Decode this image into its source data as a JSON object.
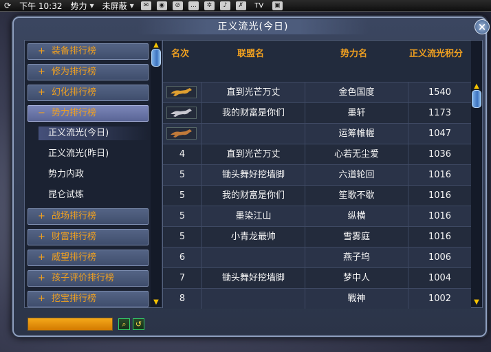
{
  "hud": {
    "time": "下午 10:32",
    "faction": "势力",
    "block": "未屏蔽",
    "tv": "TV"
  },
  "window": {
    "title": "正义流光(今日)"
  },
  "categories": [
    {
      "label": "装备排行榜",
      "sign": "+"
    },
    {
      "label": "修为排行榜",
      "sign": "+"
    },
    {
      "label": "幻化排行榜",
      "sign": "+"
    },
    {
      "label": "势力排行榜",
      "sign": "−"
    },
    {
      "label": "战场排行榜",
      "sign": "+"
    },
    {
      "label": "财富排行榜",
      "sign": "+"
    },
    {
      "label": "威望排行榜",
      "sign": "+"
    },
    {
      "label": "孩子评价排行榜",
      "sign": "+"
    },
    {
      "label": "挖宝排行榜",
      "sign": "+"
    }
  ],
  "subitems": [
    "正义流光(今日)",
    "正义流光(昨日)",
    "势力内政",
    "昆仑试炼"
  ],
  "table": {
    "headers": [
      "名次",
      "联盟名",
      "势力名",
      "正义流光积分"
    ],
    "rows": [
      {
        "rank": "",
        "medal": "gold",
        "alliance": "直到光芒万丈",
        "faction": "金色国度",
        "score": "1540"
      },
      {
        "rank": "",
        "medal": "silver",
        "alliance": "我的财富是你们",
        "faction": "墨轩",
        "score": "1173"
      },
      {
        "rank": "",
        "medal": "bronze",
        "alliance": "",
        "faction": "运筹帷幄",
        "score": "1047"
      },
      {
        "rank": "4",
        "medal": "",
        "alliance": "直到光芒万丈",
        "faction": "心若无尘爱",
        "score": "1036"
      },
      {
        "rank": "5",
        "medal": "",
        "alliance": "锄头舞好挖墙脚",
        "faction": "六道轮回",
        "score": "1016"
      },
      {
        "rank": "5",
        "medal": "",
        "alliance": "我的财富是你们",
        "faction": "笙歌不歇",
        "score": "1016"
      },
      {
        "rank": "5",
        "medal": "",
        "alliance": "墨染江山",
        "faction": "纵横",
        "score": "1016"
      },
      {
        "rank": "5",
        "medal": "",
        "alliance": "小青龙最帅",
        "faction": "雪雾庭",
        "score": "1016"
      },
      {
        "rank": "6",
        "medal": "",
        "alliance": "",
        "faction": "燕子坞",
        "score": "1006"
      },
      {
        "rank": "7",
        "medal": "",
        "alliance": "锄头舞好挖墙脚",
        "faction": "梦中人",
        "score": "1004"
      },
      {
        "rank": "8",
        "medal": "",
        "alliance": "",
        "faction": "戰神",
        "score": "1002"
      }
    ]
  },
  "colors": {
    "accent": "#f0a020",
    "gold": "#e0a030",
    "silver": "#c8c8d0",
    "bronze": "#c07a3a"
  }
}
